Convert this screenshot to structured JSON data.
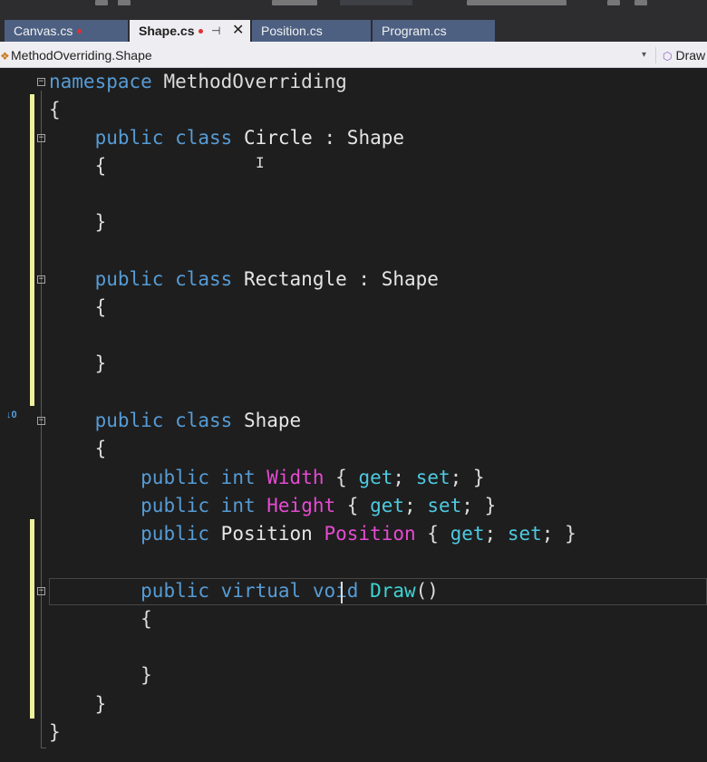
{
  "tabs": [
    {
      "label": "Canvas.cs",
      "modified": true,
      "active": false
    },
    {
      "label": "Shape.cs",
      "modified": true,
      "active": true,
      "pin_glyph": "⊣",
      "close_glyph": "✕"
    },
    {
      "label": "Position.cs",
      "modified": false,
      "active": false
    },
    {
      "label": "Program.cs",
      "modified": false,
      "active": false
    }
  ],
  "navbar": {
    "type_selector": "MethodOverriding.Shape",
    "member_selector": "Draw",
    "dropdown_glyph": "▾"
  },
  "codelens": {
    "text": "↓0"
  },
  "code": {
    "namespace_kw": "namespace",
    "namespace_name": "MethodOverriding",
    "open_brace": "{",
    "close_brace": "}",
    "public": "public",
    "class": "class",
    "colon": ":",
    "int": "int",
    "virtual": "virtual",
    "void": "void",
    "get": "get",
    "set": "set",
    "circle": "Circle",
    "rectangle": "Rectangle",
    "shape": "Shape",
    "position_type": "Position",
    "width": "Width",
    "height": "Height",
    "position_prop": "Position",
    "draw": "Draw",
    "parens": "()"
  },
  "colors": {
    "keyword": "#569cd6",
    "property": "#e64ad2",
    "accessor": "#4ec9e0",
    "method": "#3dd3d3",
    "change_bar": "#efef9e",
    "active_tab": "#eeeef2",
    "inactive_tab": "#4d6082"
  }
}
